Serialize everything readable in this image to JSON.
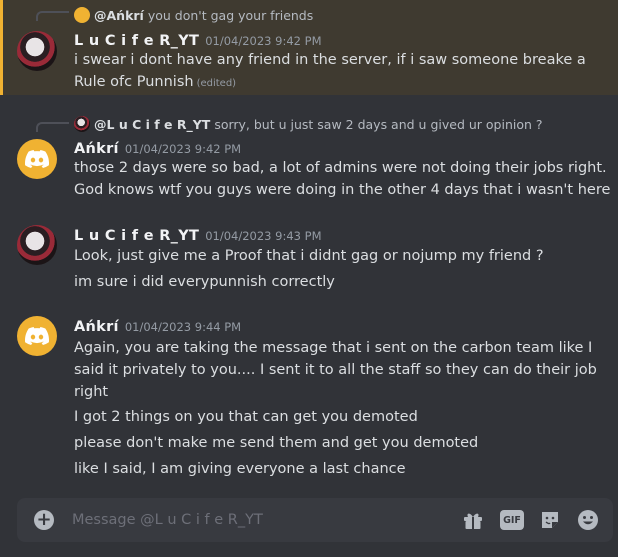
{
  "messages": [
    {
      "reply": {
        "name": "@Ańkrí",
        "text": "you don't gag your friends"
      },
      "author": "L u C i f e R_YT",
      "timestamp": "01/04/2023 9:42 PM",
      "lines": [
        "i swear i dont have any friend in the server, if i saw someone breake a",
        "Rule ofc Punnish"
      ],
      "edited": "(edited)"
    },
    {
      "reply": {
        "name": "@L u C i f e R_YT",
        "text": "sorry, but u just saw 2 days and u gived ur opinion ?"
      },
      "author": "Ańkrí",
      "timestamp": "01/04/2023 9:42 PM",
      "lines": [
        "those 2 days were so bad, a lot of admins were not doing their jobs right.",
        "God knows wtf you guys were doing in the other 4 days that i wasn't here"
      ]
    },
    {
      "author": "L u C i f e R_YT",
      "timestamp": "01/04/2023 9:43 PM",
      "lines": [
        "Look, just give me a Proof that i didnt gag or nojump my friend ?",
        "im sure i did everypunnish correctly"
      ]
    },
    {
      "author": "Ańkrí",
      "timestamp": "01/04/2023 9:44 PM",
      "lines": [
        "Again, you are taking the message that i sent on the carbon team like I",
        "said it privately to you.... I sent it to all the staff so they can do their job",
        "right",
        "I got 2 things on you that can get you demoted",
        "please don't make me send them and get you demoted",
        "like I said, I am giving everyone a last chance"
      ]
    }
  ],
  "composer": {
    "placeholder": "Message @L u C i f e R_YT",
    "gif_label": "GIF"
  },
  "colors": {
    "background": "#313338",
    "highlight": "#3f3a30",
    "mention_bar": "#f0b232",
    "composer": "#383a40"
  },
  "icons": [
    "discord-avatar-icon",
    "add-attachment-icon",
    "gift-icon",
    "gif-icon",
    "sticker-icon",
    "emoji-icon"
  ]
}
